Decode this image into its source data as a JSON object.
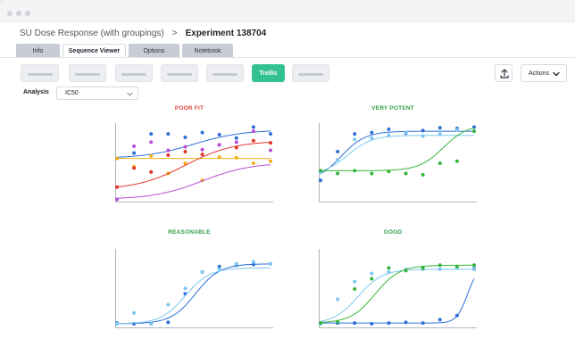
{
  "window": {
    "traffic_lights": [
      "dot",
      "dot",
      "dot"
    ]
  },
  "breadcrumb": {
    "root": "SU Dose Response (with groupings)",
    "separator": ">",
    "current": "Experiment 138704"
  },
  "tabs": [
    {
      "label": "Info",
      "active": false
    },
    {
      "label": "Sequence Viewer",
      "active": true
    },
    {
      "label": "Options",
      "active": false
    },
    {
      "label": "Notebook",
      "active": false
    }
  ],
  "toolbar": {
    "trellis_label": "Trellis",
    "actions_label": "Actions",
    "export_icon": "upload-icon",
    "placeholder_buttons": 6
  },
  "analysis": {
    "label": "Analysis",
    "selected": "IC50"
  },
  "colors": {
    "accent_green": "#33c28f",
    "poor_fit_title": "#e0493f",
    "good_title": "#2f9e44",
    "dark_blue": "#2f6fd6",
    "light_blue": "#7dc8f0",
    "green": "#35b53a",
    "red": "#e0352b",
    "orange": "#f2b018",
    "purple": "#b84fd6",
    "violet_pt": "#a06be0"
  },
  "chart_data": [
    {
      "type": "scatter",
      "title": "POOR FIT",
      "title_color": "#e0493f",
      "series": [
        {
          "color": "#2f6fd6",
          "x": [
            1,
            2,
            3,
            4,
            5,
            6,
            7,
            8,
            9,
            10
          ],
          "y": [
            0.62,
            0.7,
            0.98,
            0.98,
            0.93,
            1.0,
            0.97,
            0.92,
            1.08,
            0.98
          ],
          "curve": [
            0.62,
            1.04
          ]
        },
        {
          "color": "#f2b018",
          "x": [
            1,
            2,
            3,
            4,
            5,
            6,
            7,
            8,
            9,
            10
          ],
          "y": [
            0.62,
            0.5,
            0.66,
            0.4,
            0.55,
            0.3,
            0.64,
            0.63,
            0.55,
            0.58
          ],
          "curve": [
            0.62,
            0.62
          ]
        },
        {
          "color": "#e0352b",
          "x": [
            1,
            2,
            3,
            4,
            5,
            6,
            7,
            8,
            9,
            10
          ],
          "y": [
            0.2,
            0.48,
            0.42,
            0.67,
            0.72,
            0.68,
            0.82,
            0.78,
            0.88,
            0.85
          ],
          "curve": [
            0.16,
            0.88
          ]
        },
        {
          "color": "#b84fd6",
          "x": [
            1,
            2,
            3,
            4,
            5,
            6,
            7,
            8,
            9,
            10
          ],
          "y": [
            0.02,
            0.8,
            0.86,
            0.74,
            0.79,
            0.75,
            0.82,
            0.86,
            1.02,
            0.74
          ],
          "curve": [
            0.02,
            0.56
          ]
        }
      ]
    },
    {
      "type": "scatter",
      "title": "VERY POTENT",
      "title_color": "#2f9e44",
      "series": [
        {
          "color": "#2f6fd6",
          "x": [
            1,
            2,
            3,
            4,
            5,
            6,
            7,
            8,
            9,
            10
          ],
          "y": [
            0.3,
            0.72,
            0.98,
            1.0,
            1.05,
            0.99,
            1.03,
            1.07,
            1.06,
            1.08
          ],
          "curve": [
            0.28,
            1.02
          ]
        },
        {
          "color": "#7dc8f0",
          "x": [
            1,
            2,
            3,
            4,
            5,
            6,
            7,
            8,
            9,
            10
          ],
          "y": [
            0.42,
            0.6,
            0.9,
            0.92,
            0.96,
            1.0,
            0.95,
            0.98,
            1.04,
            1.02
          ],
          "curve": [
            0.38,
            0.96
          ]
        },
        {
          "color": "#35b53a",
          "x": [
            1,
            2,
            3,
            4,
            5,
            6,
            7,
            8,
            9,
            10
          ],
          "y": [
            0.44,
            0.4,
            0.44,
            0.4,
            0.43,
            0.4,
            0.38,
            0.55,
            0.58,
            1.02
          ],
          "curve": [
            0.44,
            1.12
          ]
        }
      ]
    },
    {
      "type": "scatter",
      "title": "REASONABLE",
      "title_color": "#2f9e44",
      "series": [
        {
          "color": "#2f6fd6",
          "x": [
            1,
            2,
            3,
            4,
            5,
            6,
            7,
            8,
            9,
            10
          ],
          "y": [
            0.05,
            0.04,
            0.04,
            0.06,
            0.48,
            0.8,
            0.88,
            0.9,
            0.91,
            0.92
          ],
          "curve": [
            0.04,
            0.92
          ]
        },
        {
          "color": "#7dc8f0",
          "x": [
            1,
            2,
            3,
            4,
            5,
            6,
            7,
            8,
            9,
            10
          ],
          "y": [
            0.04,
            0.2,
            0.04,
            0.32,
            0.56,
            0.8,
            0.84,
            0.92,
            0.95,
            0.92
          ],
          "curve": [
            0.04,
            0.86
          ]
        }
      ]
    },
    {
      "type": "scatter",
      "title": "GOOD",
      "title_color": "#2f9e44",
      "series": [
        {
          "color": "#2f6fd6",
          "x": [
            1,
            2,
            3,
            4,
            5,
            6,
            7,
            8,
            9,
            10
          ],
          "y": [
            0.05,
            0.05,
            0.05,
            0.04,
            0.05,
            0.06,
            0.05,
            0.1,
            0.16,
            0.85
          ],
          "curve": [
            0.05,
            0.88
          ]
        },
        {
          "color": "#7dc8f0",
          "x": [
            1,
            2,
            3,
            4,
            5,
            6,
            7,
            8,
            9,
            10
          ],
          "y": [
            0.04,
            0.4,
            0.66,
            0.78,
            0.8,
            0.84,
            0.84,
            0.84,
            0.86,
            0.84
          ],
          "curve": [
            0.04,
            0.84
          ]
        },
        {
          "color": "#35b53a",
          "x": [
            1,
            2,
            3,
            4,
            5,
            6,
            7,
            8,
            9,
            10
          ],
          "y": [
            0.05,
            0.07,
            0.55,
            0.7,
            0.86,
            0.82,
            0.86,
            0.9,
            0.88,
            0.9
          ],
          "curve": [
            0.05,
            0.9
          ]
        }
      ]
    }
  ]
}
